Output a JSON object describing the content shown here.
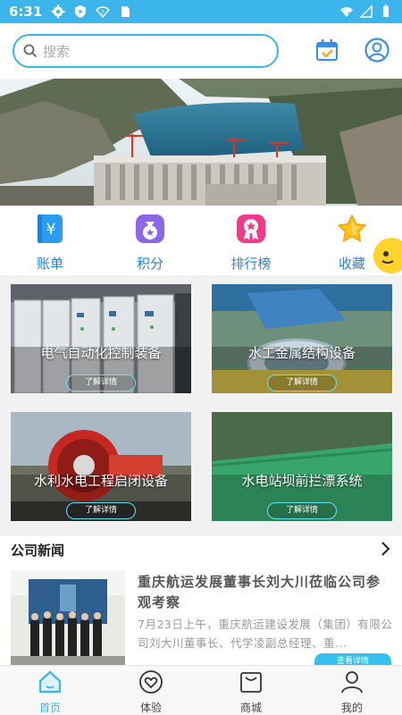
{
  "status_bar": {
    "time": "6:31"
  },
  "header": {
    "search_placeholder": "搜索"
  },
  "quick_nav": [
    {
      "label": "账单",
      "icon": "ledger-icon",
      "color": "#2c9cf3"
    },
    {
      "label": "积分",
      "icon": "money-bag-icon",
      "color": "#8e66ea"
    },
    {
      "label": "排行榜",
      "icon": "award-ribbon-icon",
      "color": "#f5398a"
    },
    {
      "label": "收藏",
      "icon": "star-icon",
      "color": "#ffc21a"
    }
  ],
  "products": [
    {
      "title": "电气自动化控制装备",
      "button": "了解详情"
    },
    {
      "title": "水工金属结构设备",
      "button": "了解详情"
    },
    {
      "title": "水利水电工程启闭设备",
      "button": "了解详情"
    },
    {
      "title": "水电站坝前拦漂系统",
      "button": "了解详情"
    }
  ],
  "news": {
    "section_title": "公司新闻",
    "items": [
      {
        "headline": "重庆航运发展董事长刘大川莅临公司参观考察",
        "summary": "7月23日上午，重庆航运建设发展（集团）有限公司刘大川董事长、代学凌副总经理、重...",
        "button": "查看详情"
      }
    ]
  },
  "tabs": [
    {
      "label": "首页",
      "icon": "home-icon",
      "active": true
    },
    {
      "label": "体验",
      "icon": "heart-icon",
      "active": false
    },
    {
      "label": "商城",
      "icon": "shopping-bag-icon",
      "active": false
    },
    {
      "label": "我的",
      "icon": "user-icon",
      "active": false
    }
  ],
  "colors": {
    "accent": "#3bb5ec",
    "nav_label": "#2e7fd8",
    "card_button_border": "#66e2f6"
  }
}
